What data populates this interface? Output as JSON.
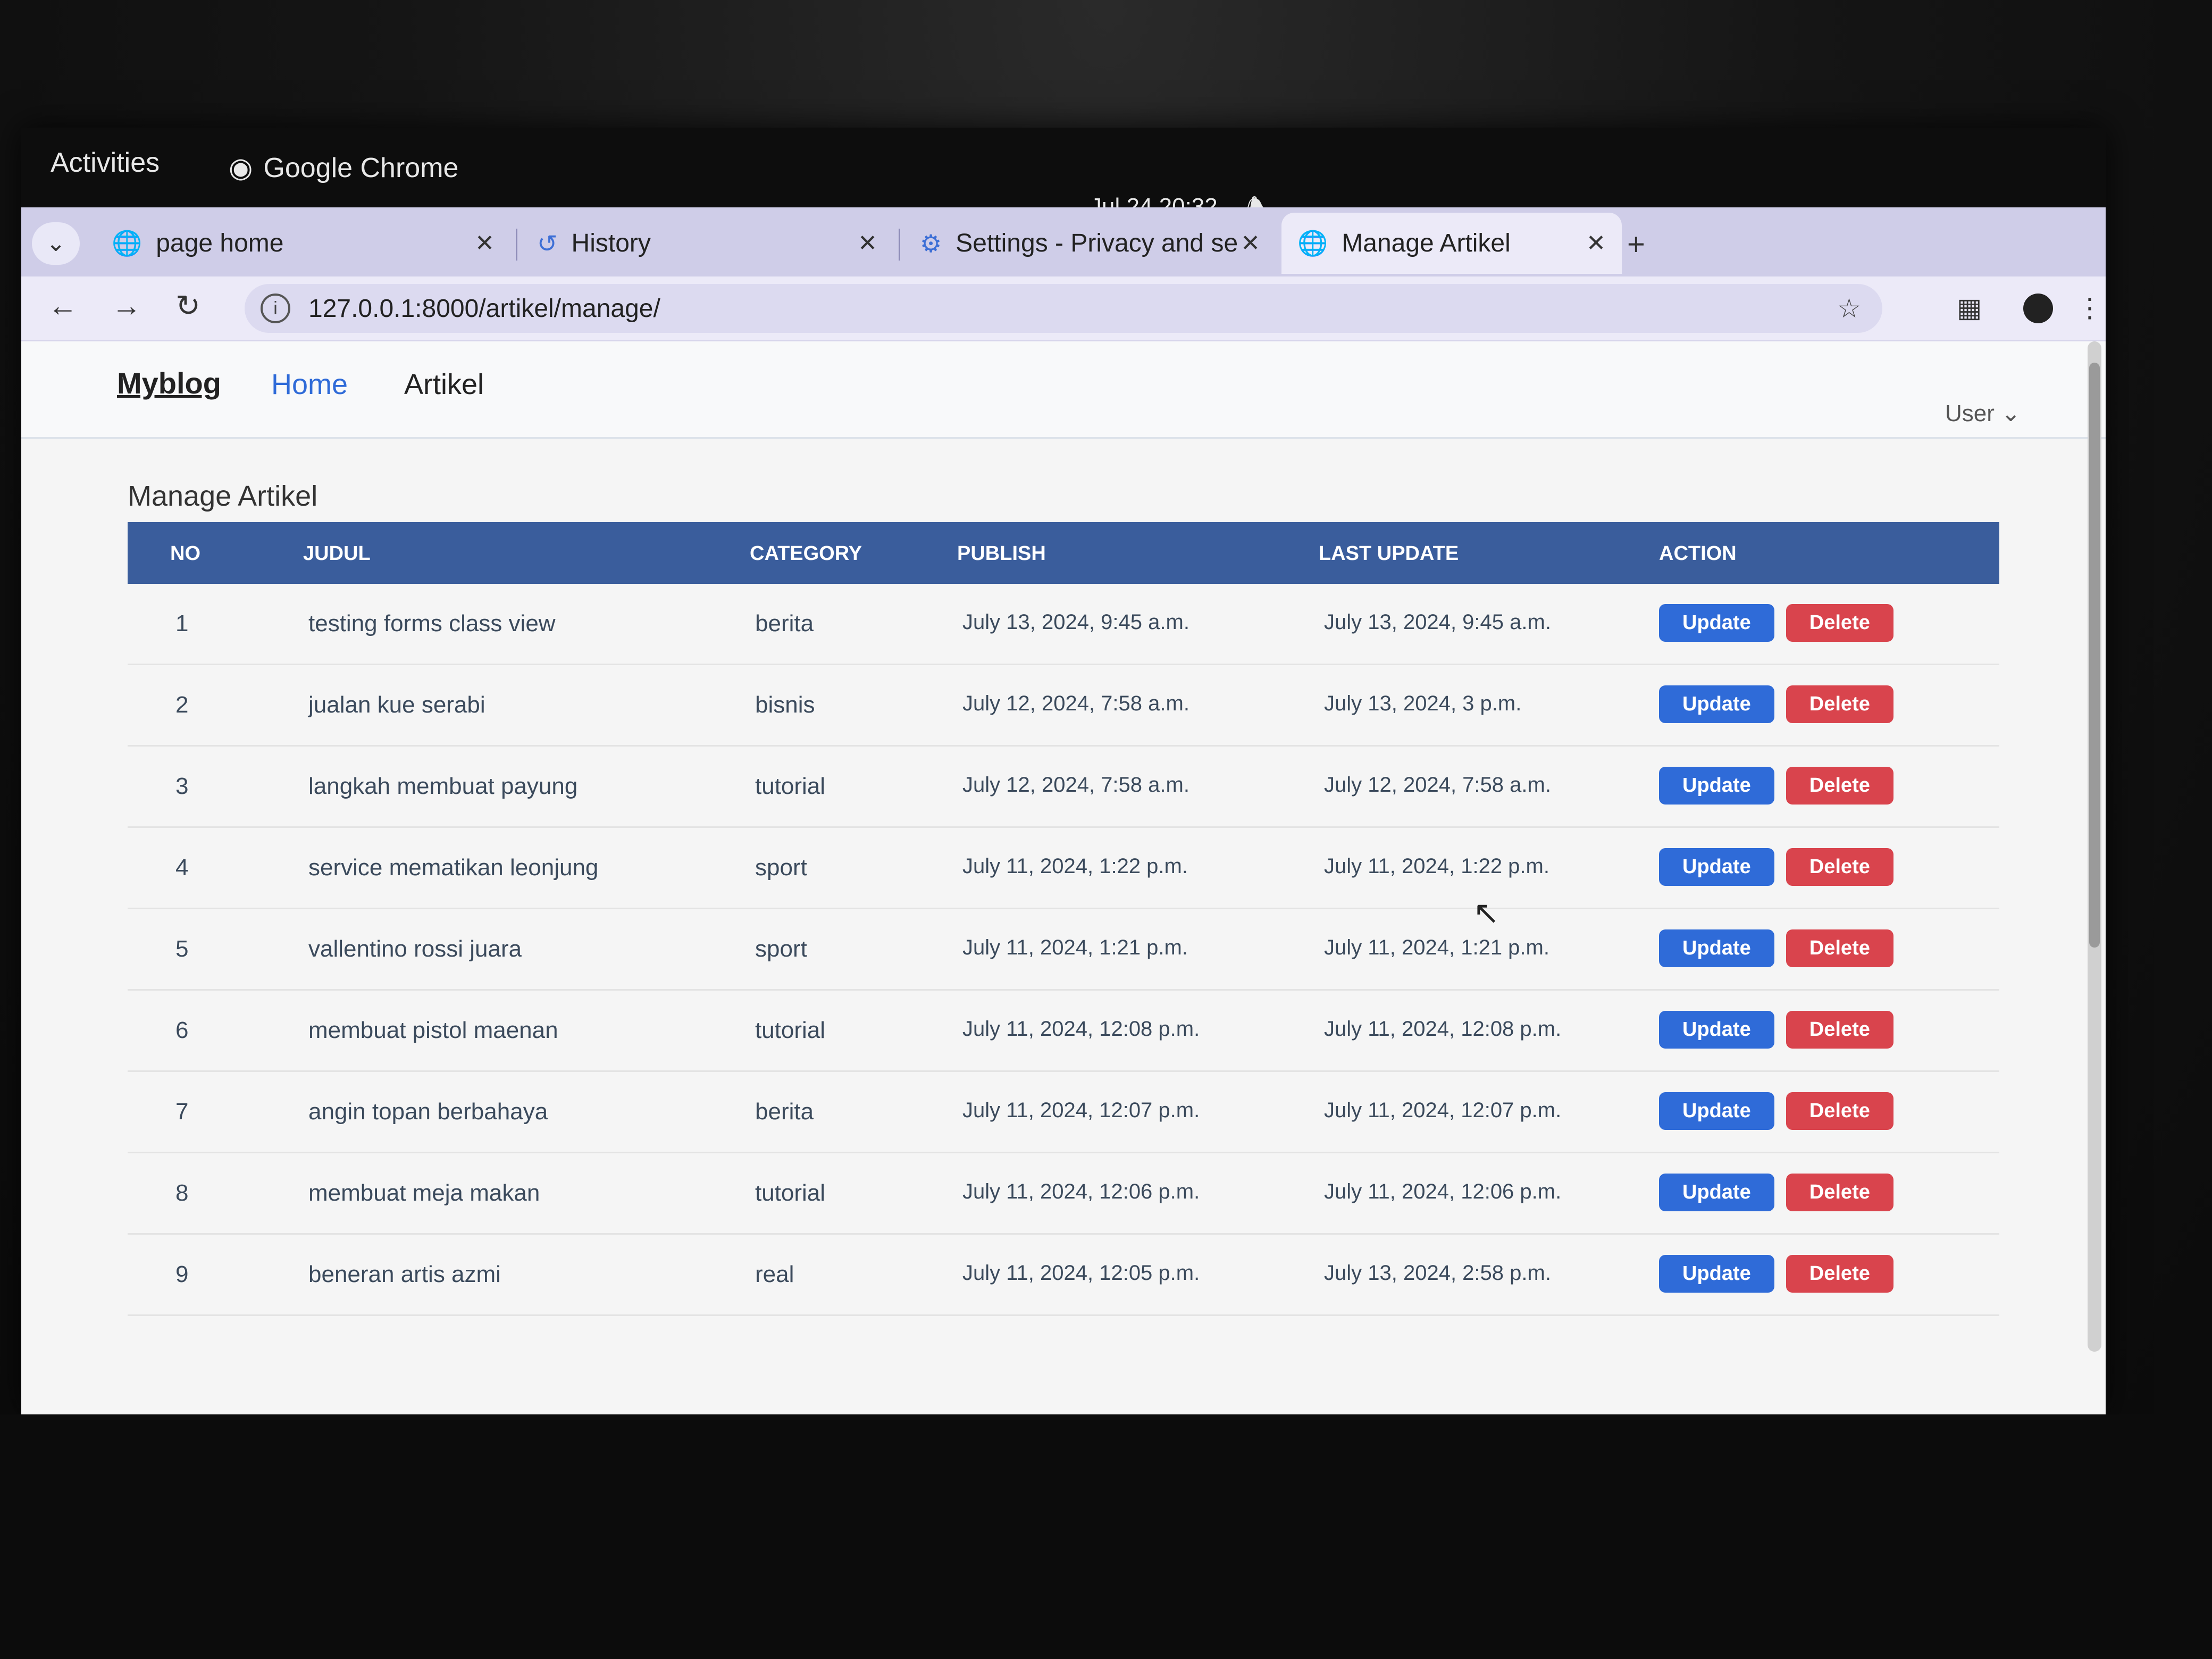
{
  "system": {
    "activities": "Activities",
    "app_name": "Google Chrome",
    "datetime": "Jul 24  20:32"
  },
  "tabs": [
    {
      "label": "page home",
      "icon": "globe-icon"
    },
    {
      "label": "History",
      "icon": "history-icon"
    },
    {
      "label": "Settings - Privacy and se",
      "icon": "gear-icon"
    },
    {
      "label": "Manage Artikel",
      "icon": "globe-icon",
      "active": true
    }
  ],
  "address": {
    "url": "127.0.0.1:8000/artikel/manage/"
  },
  "navbar": {
    "brand": "Myblog",
    "home": "Home",
    "artikel": "Artikel",
    "user": "User"
  },
  "main": {
    "title": "Manage Artikel",
    "columns": {
      "no": "NO",
      "judul": "JUDUL",
      "category": "CATEGORY",
      "publish": "PUBLISH",
      "last_update": "LAST UPDATE",
      "action": "ACTION"
    },
    "update_label": "Update",
    "delete_label": "Delete",
    "rows": [
      {
        "no": "1",
        "judul": "testing forms class view",
        "category": "berita",
        "publish": "July 13, 2024, 9:45 a.m.",
        "last_update": "July 13, 2024, 9:45 a.m."
      },
      {
        "no": "2",
        "judul": "jualan kue serabi",
        "category": "bisnis",
        "publish": "July 12, 2024, 7:58 a.m.",
        "last_update": "July 13, 2024, 3 p.m."
      },
      {
        "no": "3",
        "judul": "langkah membuat payung",
        "category": "tutorial",
        "publish": "July 12, 2024, 7:58 a.m.",
        "last_update": "July 12, 2024, 7:58 a.m."
      },
      {
        "no": "4",
        "judul": "service mematikan leonjung",
        "category": "sport",
        "publish": "July 11, 2024, 1:22 p.m.",
        "last_update": "July 11, 2024, 1:22 p.m."
      },
      {
        "no": "5",
        "judul": "vallentino rossi juara",
        "category": "sport",
        "publish": "July 11, 2024, 1:21 p.m.",
        "last_update": "July 11, 2024, 1:21 p.m."
      },
      {
        "no": "6",
        "judul": "membuat pistol maenan",
        "category": "tutorial",
        "publish": "July 11, 2024, 12:08 p.m.",
        "last_update": "July 11, 2024, 12:08 p.m."
      },
      {
        "no": "7",
        "judul": "angin topan berbahaya",
        "category": "berita",
        "publish": "July 11, 2024, 12:07 p.m.",
        "last_update": "July 11, 2024, 12:07 p.m."
      },
      {
        "no": "8",
        "judul": "membuat meja makan",
        "category": "tutorial",
        "publish": "July 11, 2024, 12:06 p.m.",
        "last_update": "July 11, 2024, 12:06 p.m."
      },
      {
        "no": "9",
        "judul": "beneran artis azmi",
        "category": "real",
        "publish": "July 11, 2024, 12:05 p.m.",
        "last_update": "July 13, 2024, 2:58 p.m."
      }
    ]
  }
}
